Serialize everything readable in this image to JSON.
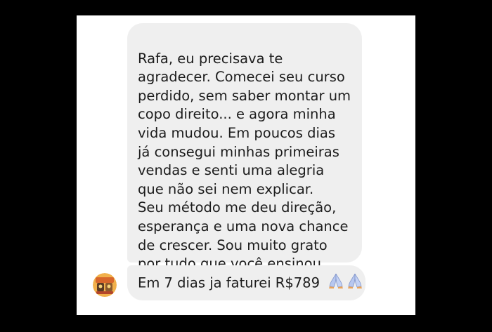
{
  "messages": [
    {
      "text": "Rafa, eu precisava te\nagradecer. Comecei seu curso\nperdido, sem saber montar um\ncopo direito... e agora minha\nvida mudou. Em poucos dias\njá consegui minhas primeiras\nvendas e senti uma alegria\nque não sei nem explicar.\nSeu método me deu direção,\nesperança e uma nova chance\nde crescer. Sou muito grato\npor tudo que você ensinou"
    },
    {
      "text": "Em 7 dias ja faturei R$789",
      "emoji": "folded-hands-icon"
    }
  ],
  "colors": {
    "page_background": "#000000",
    "panel_background": "#ffffff",
    "bubble_background": "#efefef",
    "text": "#1c1c1c",
    "avatar_accent": "#e8902a"
  }
}
